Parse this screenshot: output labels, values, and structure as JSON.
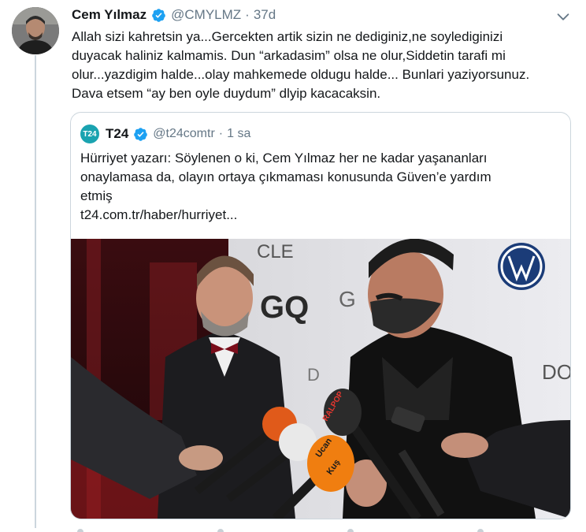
{
  "tweet": {
    "author_name": "Cem Yılmaz",
    "handle": "@CMYLMZ",
    "separator": "·",
    "time": "37d",
    "text_lines": [
      "Allah sizi kahretsin ya...Gercekten artik  sizin ne dediginiz,ne soylediginizi",
      "duyacak haliniz kalmamis. Dun “arkadasim” olsa ne olur,Siddetin tarafi mi",
      "olur...yazdigim halde...olay mahkemede oldugu halde... Bunlari yaziyorsunuz.",
      "Dava etsem “ay ben oyle duydum” dlyip kacacaksin."
    ]
  },
  "quote": {
    "logo_text": "T24",
    "author_name": "T24",
    "handle": "@t24comtr",
    "separator": "·",
    "time": "1 sa",
    "text_lines": [
      "Hürriyet yazarı: Söylenen o ki, Cem Yılmaz her ne kadar yaşananları",
      "onaylamasa da, olayın ortaya çıkmaması konusunda Güven’e yardım",
      "etmiş"
    ],
    "link": "t24.com.tr/haber/hurriyet..."
  },
  "photo": {
    "backdrop_text": [
      "CLE",
      "GQ",
      "G",
      "DO",
      "D"
    ],
    "mic_labels": [
      "Ucan",
      "Kuş",
      "RALPOP"
    ]
  },
  "colors": {
    "verified": "#1da1f2",
    "muted": "#657786",
    "link": "#14171a",
    "border": "#ccd6dd",
    "t24_logo": "#1aa3b0"
  },
  "icons": [
    "verified-badge-icon",
    "chevron-down-icon"
  ]
}
